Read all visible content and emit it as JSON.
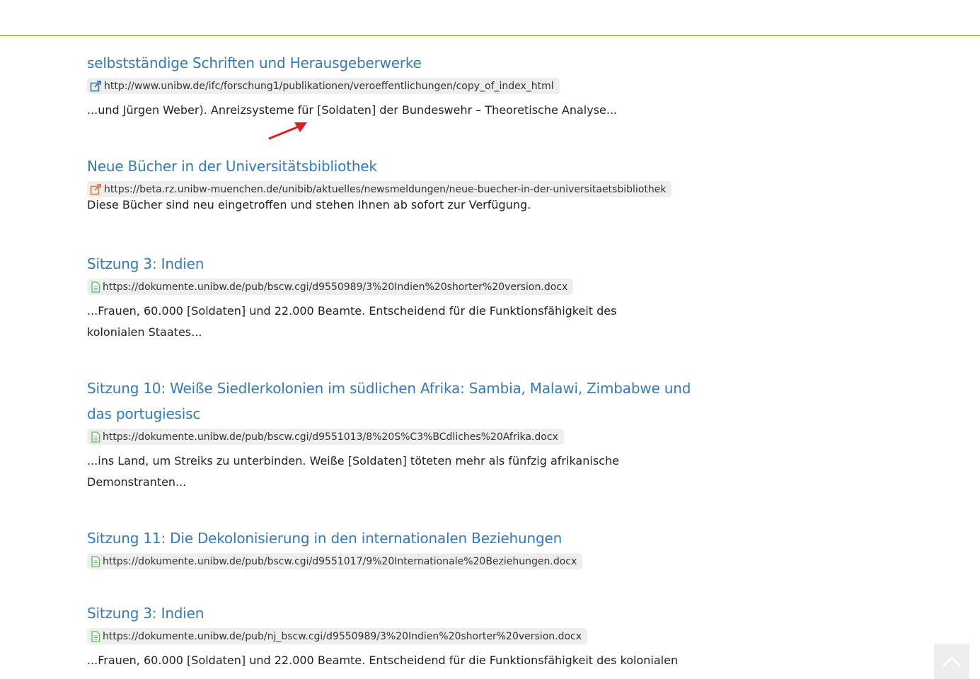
{
  "results": [
    {
      "title": "selbstständige Schriften und Herausgeberwerke",
      "icon": "external-link-icon",
      "icon_color": "#337ab7",
      "url": "http://www.unibw.de/ifc/forschung1/publikationen/veroeffentlichungen/copy_of_index_html",
      "snippet": "...und Jürgen Weber). Anreizsysteme für [Soldaten] der Bundeswehr – Theoretische Analyse..."
    },
    {
      "title": "Neue Bücher in der Universitätsbibliothek",
      "icon": "external-link-icon",
      "icon_color": "#e07a2e",
      "url": "https://beta.rz.unibw-muenchen.de/unibib/aktuelles/newsmeldungen/neue-buecher-in-der-universitaetsbibliothek",
      "snippet": "Diese Bücher sind neu eingetroffen und stehen Ihnen ab sofort zur Verfügung."
    },
    {
      "title": "Sitzung 3: Indien",
      "icon": "document-icon",
      "icon_color": "#5cb85c",
      "url": "https://dokumente.unibw.de/pub/bscw.cgi/d9550989/3%20Indien%20shorter%20version.docx",
      "snippet": "...Frauen, 60.000 [Soldaten] und 22.000 Beamte. Entscheidend für die Funktionsfähigkeit des kolonialen Staates..."
    },
    {
      "title": "Sitzung 10: Weiße Siedlerkolonien im südlichen Afrika: Sambia, Malawi, Zimbabwe und das portugiesisc",
      "icon": "document-icon",
      "icon_color": "#5cb85c",
      "url": "https://dokumente.unibw.de/pub/bscw.cgi/d9551013/8%20S%C3%BCdliches%20Afrika.docx",
      "snippet": "...ins Land, um Streiks zu unterbinden. Weiße [Soldaten] töteten mehr als fünfzig afrikanische Demonstranten..."
    },
    {
      "title": "Sitzung 11: Die Dekolonisierung in den internationalen Beziehungen",
      "icon": "document-icon",
      "icon_color": "#5cb85c",
      "url": "https://dokumente.unibw.de/pub/bscw.cgi/d9551017/9%20Internationale%20Beziehungen.docx",
      "snippet": ""
    },
    {
      "title": "Sitzung 3: Indien",
      "icon": "document-icon",
      "icon_color": "#5cb85c",
      "url": "https://dokumente.unibw.de/pub/nj_bscw.cgi/d9550989/3%20Indien%20shorter%20version.docx",
      "snippet": "...Frauen, 60.000 [Soldaten] und 22.000 Beamte. Entscheidend für die Funktionsfähigkeit des kolonialen"
    }
  ],
  "colors": {
    "link": "#337ab7",
    "accent": "#e07a2e",
    "annotation_arrow": "#e02020"
  },
  "icons": {
    "annotation": "red-arrow-icon",
    "scroll_top": "chevron-up-icon"
  }
}
